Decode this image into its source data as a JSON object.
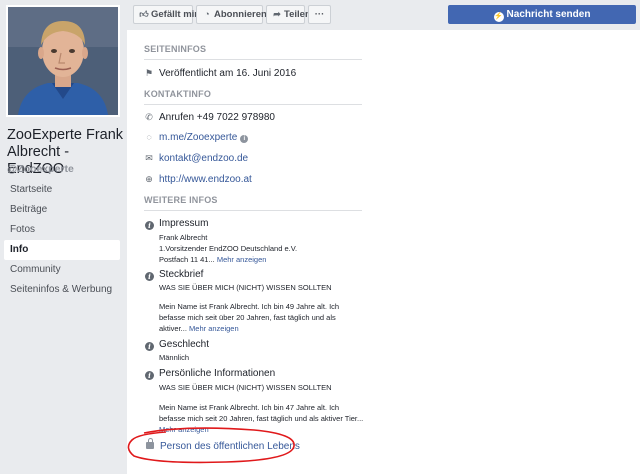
{
  "profile": {
    "name": "ZooExperte Frank Albrecht - EndZOO",
    "handle": "@Zooexperte"
  },
  "nav": {
    "items": [
      {
        "label": "Startseite"
      },
      {
        "label": "Beiträge"
      },
      {
        "label": "Fotos"
      },
      {
        "label": "Info",
        "active": true
      },
      {
        "label": "Community"
      },
      {
        "label": "Seiteninfos & Werbung"
      }
    ]
  },
  "actions": {
    "like_label": "Gefällt mir",
    "subscribe_label": "Abonnieren",
    "share_label": "Teilen",
    "more_label": "···",
    "message_label": "Nachricht senden"
  },
  "page_info": {
    "heading": "SEITENINFOS",
    "published": "Veröffentlicht am 16. Juni 2016"
  },
  "contact": {
    "heading": "KONTAKTINFO",
    "phone": "Anrufen +49 7022 978980",
    "messenger": "m.me/Zooexperte",
    "email": "kontakt@endzoo.de",
    "website": "http://www.endzoo.at"
  },
  "more_info": {
    "heading": "WEITERE INFOS",
    "impressum": {
      "title": "Impressum",
      "line1": "Frank Albrecht",
      "line2": "1.Vorsitzender EndZOO Deutschland e.V.",
      "line3": "Postfach 11 41...",
      "more": "Mehr anzeigen"
    },
    "steckbrief": {
      "title": "Steckbrief",
      "line1": "WAS SIE ÜBER MICH (NICHT) WISSEN SOLLTEN",
      "line2": "Mein Name ist Frank Albrecht. Ich bin 49 Jahre alt. Ich",
      "line3": "befasse mich seit über 20 Jahren, fast täglich und als",
      "line4": "aktiver...",
      "more": "Mehr anzeigen"
    },
    "geschlecht": {
      "title": "Geschlecht",
      "value": "Männlich"
    },
    "personal": {
      "title": "Persönliche Informationen",
      "line1": "WAS SIE ÜBER MICH (NICHT) WISSEN SOLLTEN",
      "line2": "Mein Name ist Frank Albrecht. Ich bin 47 Jahre alt. Ich",
      "line3": "befasse mich seit 20 Jahren, fast täglich und als aktiver Tier...",
      "more": "Mehr anzeigen"
    }
  },
  "public_figure": "Person des öffentlichen Lebens",
  "colors": {
    "accent": "#4267b2",
    "link": "#365899",
    "annotation": "#e0191b"
  }
}
